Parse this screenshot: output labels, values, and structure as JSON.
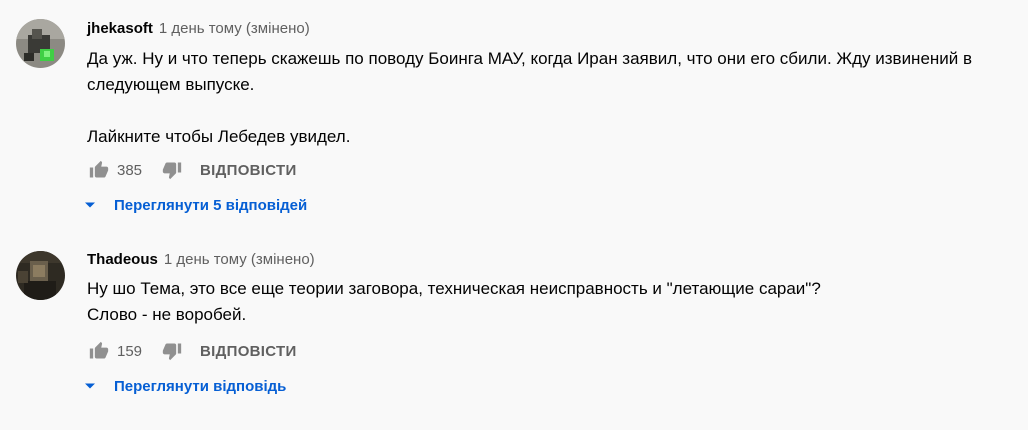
{
  "comments": [
    {
      "author": "jhekasoft",
      "time": "1 день тому (змінено)",
      "text_lines": [
        "Да уж. Ну и что теперь скажешь по поводу Боинга МАУ, когда Иран заявил, что они его сбили. Жду извинений в",
        "следующем выпуске.",
        "",
        "Лайкните чтобы Лебедев увидел."
      ],
      "likes": "385",
      "reply_label": "ВІДПОВІСТИ",
      "view_replies_label": "Переглянути 5 відповідей",
      "avatar_icon": "avatar-green-robot-icon"
    },
    {
      "author": "Thadeous",
      "time": "1 день тому (змінено)",
      "text_lines": [
        "Ну шо Тема, это все еще теории заговора, техническая неисправность и \"летающие сараи\"?",
        "Слово - не воробей."
      ],
      "likes": "159",
      "reply_label": "ВІДПОВІСТИ",
      "view_replies_label": "Переглянути відповідь",
      "avatar_icon": "avatar-dark-photo-icon"
    }
  ],
  "colors": {
    "background": "#f9f9f9",
    "text": "#030303",
    "secondary": "#606060",
    "link": "#065fd4",
    "icon": "#909090"
  },
  "icons": {
    "like": "thumbs-up-icon",
    "dislike": "thumbs-down-icon",
    "expand": "caret-down-icon"
  }
}
